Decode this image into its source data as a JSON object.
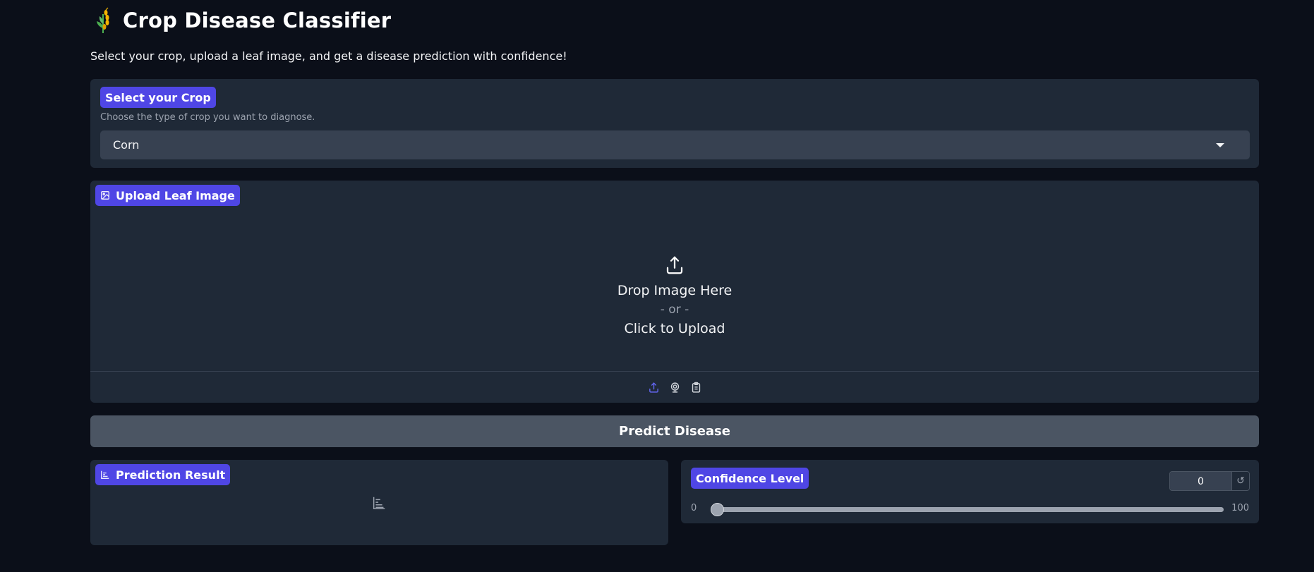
{
  "header": {
    "logo_icon": "wheat-icon",
    "title": "Crop Disease Classifier",
    "subtitle": "Select your crop, upload a leaf image, and get a disease prediction with confidence!"
  },
  "crop": {
    "label": "Select your Crop",
    "info": "Choose the type of crop you want to diagnose.",
    "selected": "Corn"
  },
  "upload": {
    "label": "Upload Leaf Image",
    "label_icon": "image-icon",
    "drop_text": "Drop Image Here",
    "or_text": "- or -",
    "click_text": "Click to Upload",
    "sources": [
      "upload-icon",
      "webcam-icon",
      "clipboard-icon"
    ]
  },
  "predict": {
    "label": "Predict Disease"
  },
  "result": {
    "label": "Prediction Result",
    "label_icon": "bar-chart-icon"
  },
  "confidence": {
    "label": "Confidence Level",
    "value": "0",
    "fraction": 0,
    "min": "0",
    "max": "100",
    "reset_glyph": "↺"
  },
  "colors": {
    "background": "#0b0f19",
    "panel": "#1f2937",
    "accent": "#4f46e5",
    "input": "#374151",
    "button": "#4b5563"
  }
}
